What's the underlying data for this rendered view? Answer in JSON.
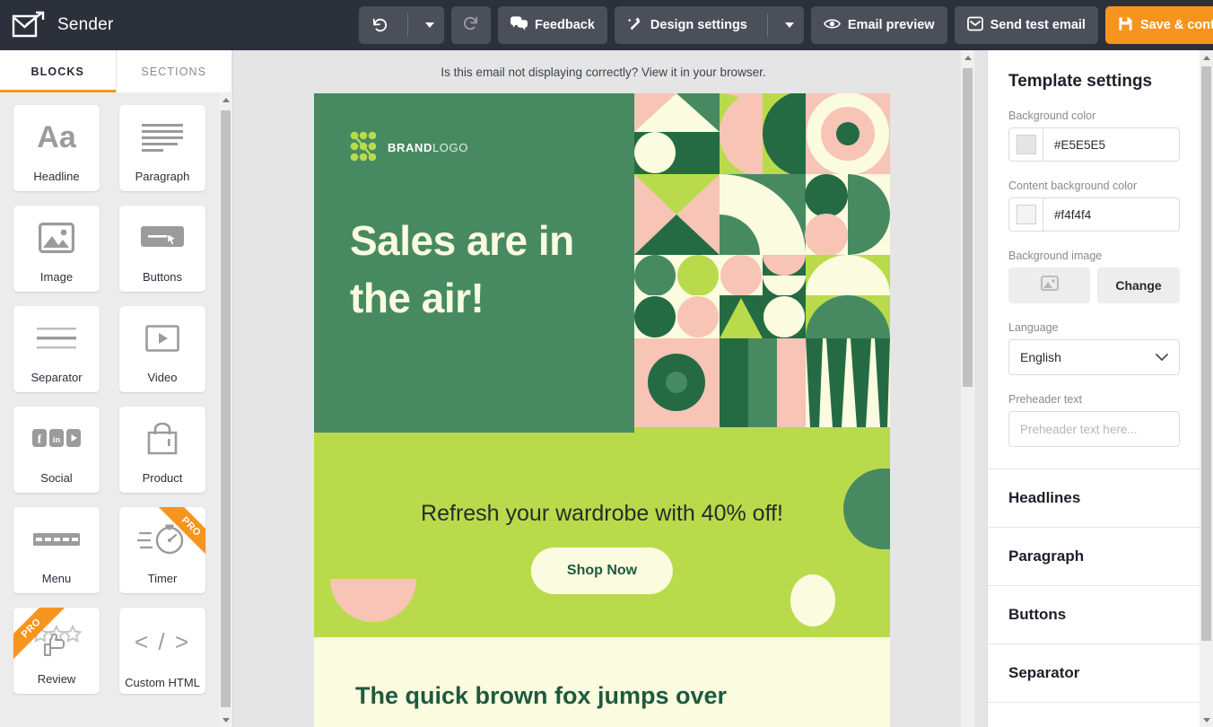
{
  "app": {
    "name": "Sender",
    "logo_icon": "envelope-arrow-icon"
  },
  "toolbar": {
    "undo_icon": "undo-icon",
    "undo_caret_icon": "caret-down-icon",
    "redo_icon": "redo-icon",
    "feedback_label": "Feedback",
    "feedback_icon": "chat-bubbles-icon",
    "design_settings_label": "Design settings",
    "design_settings_icon": "magic-wand-icon",
    "design_settings_caret_icon": "caret-down-icon",
    "email_preview_label": "Email preview",
    "email_preview_icon": "eye-icon",
    "send_test_label": "Send test email",
    "send_test_icon": "inbox-icon",
    "save_label": "Save & continue",
    "save_icon": "floppy-disk-icon",
    "accent_color": "#f7941e",
    "bar_color": "#2b303b"
  },
  "left_panel": {
    "tabs": [
      {
        "label": "BLOCKS",
        "active": true
      },
      {
        "label": "SECTIONS",
        "active": false
      }
    ],
    "blocks": [
      {
        "label": "Headline",
        "icon": "aa-text-icon",
        "pro": false
      },
      {
        "label": "Paragraph",
        "icon": "text-lines-icon",
        "pro": false
      },
      {
        "label": "Image",
        "icon": "picture-icon",
        "pro": false
      },
      {
        "label": "Buttons",
        "icon": "button-cursor-icon",
        "pro": false
      },
      {
        "label": "Separator",
        "icon": "divider-lines-icon",
        "pro": false
      },
      {
        "label": "Video",
        "icon": "video-play-icon",
        "pro": false
      },
      {
        "label": "Social",
        "icon": "social-networks-icon",
        "pro": false
      },
      {
        "label": "Product",
        "icon": "shopping-bag-icon",
        "pro": false
      },
      {
        "label": "Menu",
        "icon": "menu-dashes-icon",
        "pro": false
      },
      {
        "label": "Timer",
        "icon": "stopwatch-icon",
        "pro": true
      },
      {
        "label": "Review",
        "icon": "stars-hand-icon",
        "pro": true
      },
      {
        "label": "Custom HTML",
        "icon": "code-tags-icon",
        "pro": false
      }
    ],
    "pro_badge": "PRO"
  },
  "email": {
    "preheader_notice": "Is this email not displaying correctly? View it in your browser.",
    "logo_text_bold": "BRAND",
    "logo_text_light": "LOGO",
    "hero_title_line1": "Sales are in",
    "hero_title_line2": "the air!",
    "promo_text": "Refresh your wardrobe with 40% off!",
    "cta_label": "Shop Now",
    "article_heading": "The quick brown fox jumps over",
    "colors": {
      "hero_bg": "#478a62",
      "hero_title": "#fbfbdf",
      "promo_bg": "#b9db4b",
      "cta_bg": "#fbfbdf",
      "cta_text": "#1e5a40",
      "article_bg": "#fbfbdf",
      "article_text": "#1e5a40",
      "pattern_dark_green": "#246b43",
      "pattern_mid_green": "#4e9a68",
      "pattern_lime": "#b9db4b",
      "pattern_pink": "#f7c4b5",
      "pattern_cream": "#fbfbdf"
    }
  },
  "right_panel": {
    "title": "Template settings",
    "background_color": {
      "label": "Background color",
      "value": "#E5E5E5",
      "swatch": "#E5E5E5"
    },
    "content_background_color": {
      "label": "Content background color",
      "value": "#f4f4f4",
      "swatch": "#f4f4f4"
    },
    "background_image": {
      "label": "Background image",
      "preview_icon": "picture-icon",
      "change_label": "Change"
    },
    "language": {
      "label": "Language",
      "value": "English",
      "caret_icon": "chevron-down-icon"
    },
    "preheader": {
      "label": "Preheader text",
      "value": "",
      "placeholder": "Preheader text here..."
    },
    "sections": [
      {
        "label": "Headlines"
      },
      {
        "label": "Paragraph"
      },
      {
        "label": "Buttons"
      },
      {
        "label": "Separator"
      }
    ]
  },
  "scrollbars": {
    "up_arrow_icon": "triangle-up-icon",
    "down_arrow_icon": "triangle-down-icon"
  }
}
